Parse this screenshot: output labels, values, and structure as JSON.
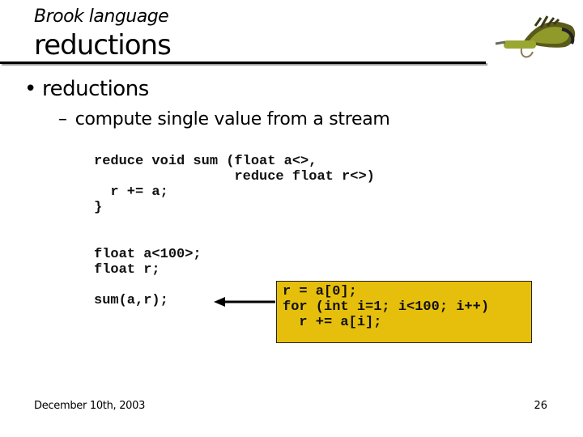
{
  "header": {
    "subtitle": "Brook language",
    "title": "reductions",
    "logo_icon": "fishing-fly-icon"
  },
  "bullets": {
    "main": {
      "marker": "•",
      "text": "reductions"
    },
    "sub": {
      "marker": "–",
      "text": "compute single value from a stream"
    }
  },
  "code": {
    "function_def": "reduce void sum (float a<>,\n                 reduce float r<>)\n  r += a;\n}",
    "declarations": "float a<100>;\nfloat r;",
    "call": "sum(a,r);",
    "equivalent": "r = a[0];\nfor (int i=1; i<100; i++)\n  r += a[i];"
  },
  "colors": {
    "highlight_box": "#e6bf0c"
  },
  "footer": {
    "date": "December 10th, 2003",
    "page_number": "26"
  }
}
